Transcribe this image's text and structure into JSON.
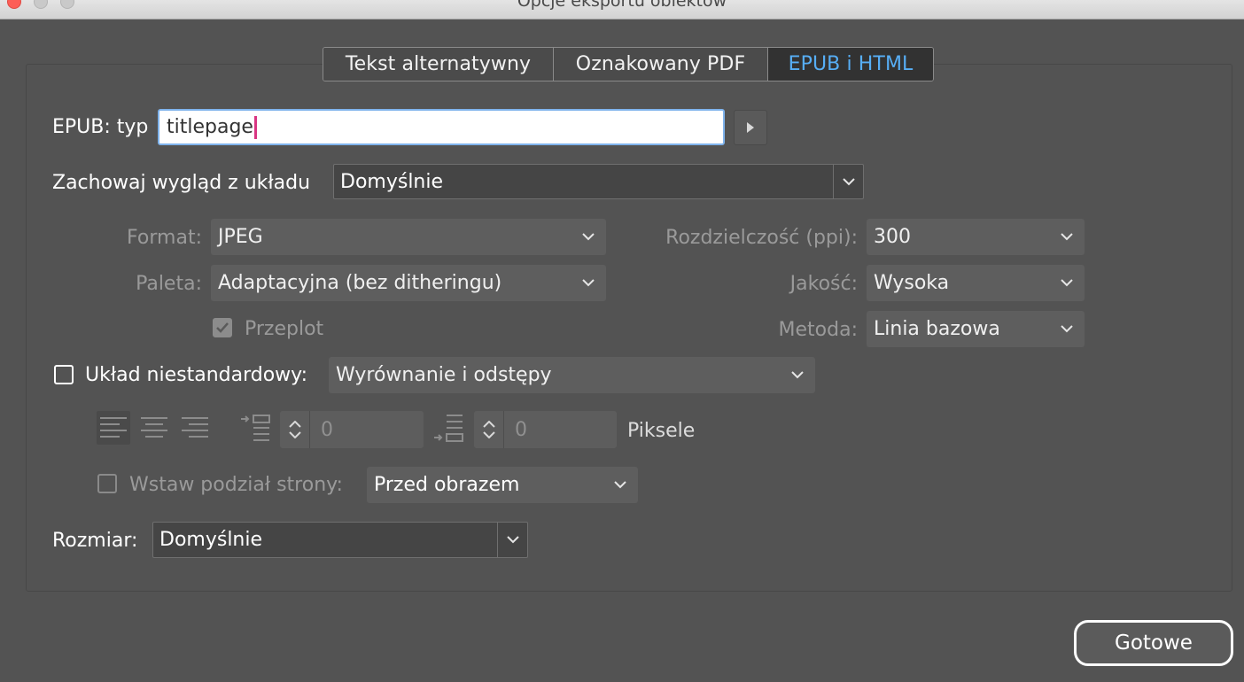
{
  "window": {
    "title": "Opcje eksportu obiektów"
  },
  "tabs": [
    {
      "label": "Tekst alternatywny",
      "active": false
    },
    {
      "label": "Oznakowany PDF",
      "active": false
    },
    {
      "label": "EPUB i HTML",
      "active": true
    }
  ],
  "epub_type": {
    "label": "EPUB: typ",
    "value": "titlepage"
  },
  "preserve_appearance": {
    "label": "Zachowaj wygląd z układu",
    "value": "Domyślnie"
  },
  "image_settings": {
    "format": {
      "label": "Format:",
      "value": "JPEG"
    },
    "resolution": {
      "label": "Rozdzielczość (ppi):",
      "value": "300"
    },
    "palette": {
      "label": "Paleta:",
      "value": "Adaptacyjna (bez ditheringu)"
    },
    "quality": {
      "label": "Jakość:",
      "value": "Wysoka"
    },
    "interlace": {
      "label": "Przeplot",
      "checked": true
    },
    "method": {
      "label": "Metoda:",
      "value": "Linia bazowa"
    }
  },
  "custom_layout": {
    "label": "Układ niestandardowy:",
    "checked": false,
    "value": "Wyrównanie i odstępy"
  },
  "spacing": {
    "before": "0",
    "after": "0",
    "units": "Piksele"
  },
  "page_break": {
    "label": "Wstaw podział strony:",
    "checked": false,
    "value": "Przed obrazem"
  },
  "size": {
    "label": "Rozmiar:",
    "value": "Domyślnie"
  },
  "done_button": {
    "label": "Gotowe"
  },
  "colors": {
    "background": "#535353",
    "active_tab_text": "#57aef5",
    "caret": "#d93582"
  }
}
